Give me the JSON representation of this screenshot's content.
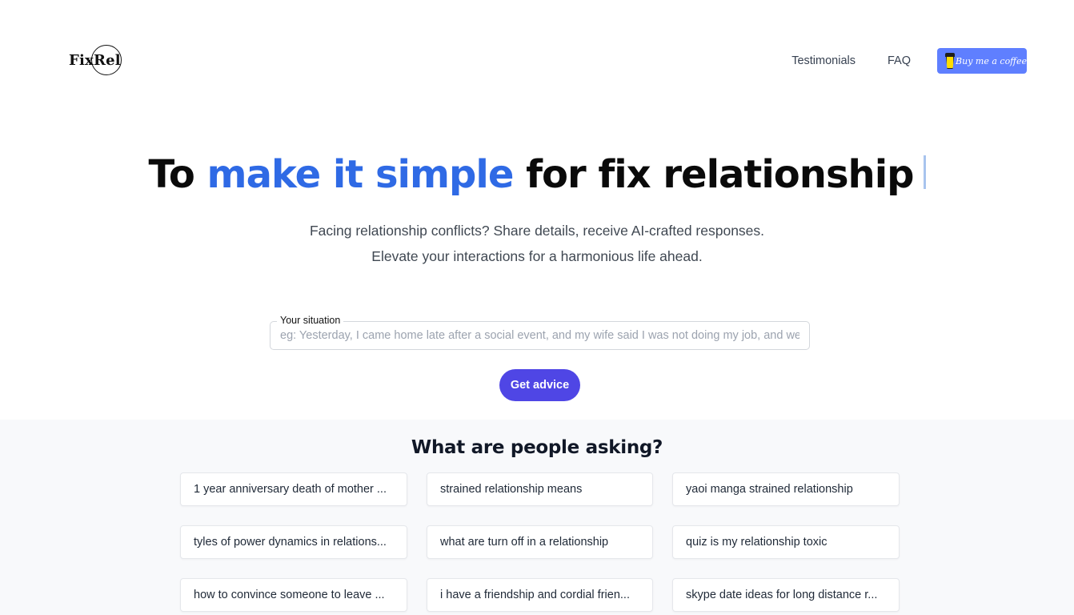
{
  "header": {
    "logo_text": "FixRel",
    "nav": [
      {
        "label": "Testimonials"
      },
      {
        "label": "FAQ"
      }
    ],
    "coffee_button": {
      "label": "Buy me a coffee",
      "icon": "coffee-cup-icon",
      "color": "#5f7fff"
    }
  },
  "hero": {
    "title_prefix": "To ",
    "title_accent": "make it simple",
    "title_suffix": " for fix relationship",
    "accent_color": "#2f6ae5",
    "subtitle_line1": "Facing relationship conflicts? Share details, receive AI-crafted responses.",
    "subtitle_line2": "Elevate your interactions for a harmonious life ahead."
  },
  "form": {
    "situation_label": "Your situation",
    "situation_value": "",
    "situation_placeholder": "eg: Yesterday, I came home late after a social event, and my wife said I was not doing my job, and we argued.",
    "submit_label": "Get advice",
    "submit_color": "#4f46e5"
  },
  "asking": {
    "heading": "What are people asking?",
    "questions": [
      "1 year anniversary death of mother ...",
      "strained relationship means",
      "yaoi manga strained relationship",
      "tyles of power dynamics in relations...",
      "what are turn off in a relationship",
      "quiz is my relationship toxic",
      "how to convince someone to leave ...",
      "i have a friendship and cordial frien...",
      "skype date ideas for long distance r..."
    ]
  }
}
